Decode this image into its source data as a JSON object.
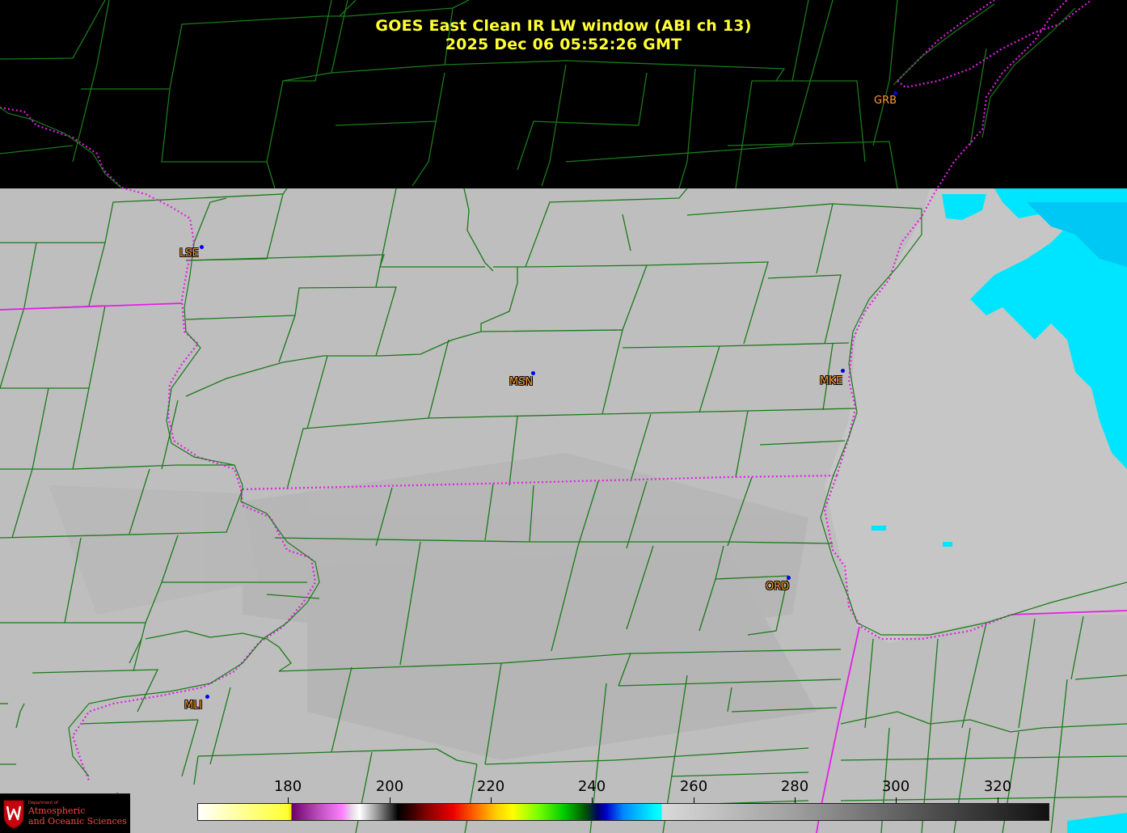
{
  "title": {
    "line1": "GOES East Clean IR LW window (ABI ch 13)",
    "line2": "2025 Dec 06  05:52:26 GMT"
  },
  "stations": [
    {
      "id": "GRB",
      "label": "GRB"
    },
    {
      "id": "LSE",
      "label": "LSE"
    },
    {
      "id": "MSN",
      "label": "MSN"
    },
    {
      "id": "MKE",
      "label": "MKE"
    },
    {
      "id": "ORD",
      "label": "ORD"
    },
    {
      "id": "MLI",
      "label": "MLI"
    }
  ],
  "colorbar": {
    "ticks": [
      "180",
      "200",
      "220",
      "240",
      "260",
      "280",
      "300",
      "320"
    ]
  },
  "logo": {
    "dept": "Department of",
    "line1": "Atmospheric",
    "line2": "and Oceanic Sciences"
  },
  "colors": {
    "title": "#ffff33",
    "county_lines": "#1a7a1a",
    "state_lines": "#e61ee6",
    "station_label": "#ff9933",
    "cloud_cyan": "#00e5ff",
    "ground_gray": "#bdbdbd"
  }
}
